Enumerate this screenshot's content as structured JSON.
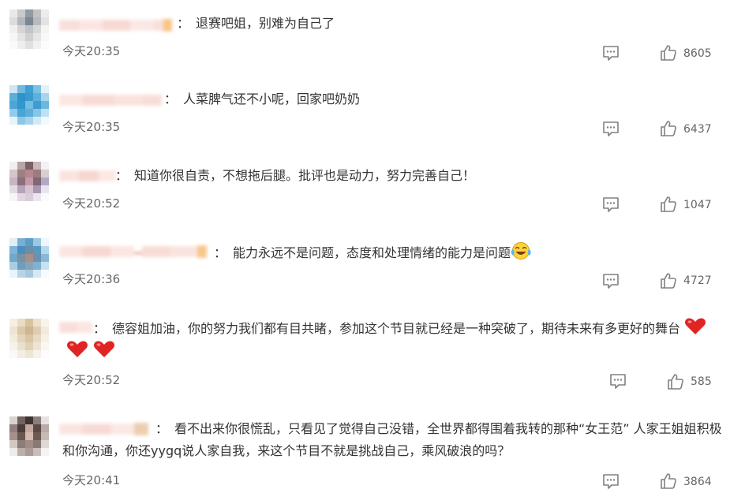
{
  "comments": [
    {
      "text": "退赛吧姐，别难为自己了",
      "time": "今天20:35",
      "likes": "8605",
      "emoji": []
    },
    {
      "text": "人菜脾气还不小呢，回家吧奶奶",
      "time": "今天20:35",
      "likes": "6437",
      "emoji": []
    },
    {
      "text": "知道你很自责，不想拖后腿。批评也是动力，努力完善自己！",
      "time": "今天20:52",
      "likes": "1047",
      "emoji": []
    },
    {
      "text": "能力永远不是问题，态度和处理情绪的能力是问题",
      "time": "今天20:36",
      "likes": "4727",
      "emoji": [
        "laugh-cry"
      ]
    },
    {
      "text": "德容姐加油，你的努力我们都有目共睹，参加这个节目就已经是一种突破了，期待未来有多更好的舞台",
      "time": "今天20:52",
      "likes": "585",
      "emoji": [
        "heart",
        "heart",
        "heart"
      ]
    },
    {
      "text": "看不出来你很慌乱，只看见了觉得自己没错，全世界都得围着我转的那种“女王范” 人家王姐姐积极和你沟通，你还yygq说人家自我，来这个节目不就是挑战自己，乘风破浪的吗？",
      "time": "今天20:41",
      "likes": "3864",
      "emoji": []
    }
  ],
  "colon": "：",
  "icons": {
    "reply": "comment-icon",
    "like": "thumbs-up-icon",
    "laugh": "laugh-cry-emoji",
    "heart": "heart-emoji"
  },
  "colors": {
    "text": "#333333",
    "meta": "#666666",
    "icon": "#808080",
    "heart": "#e02424"
  }
}
